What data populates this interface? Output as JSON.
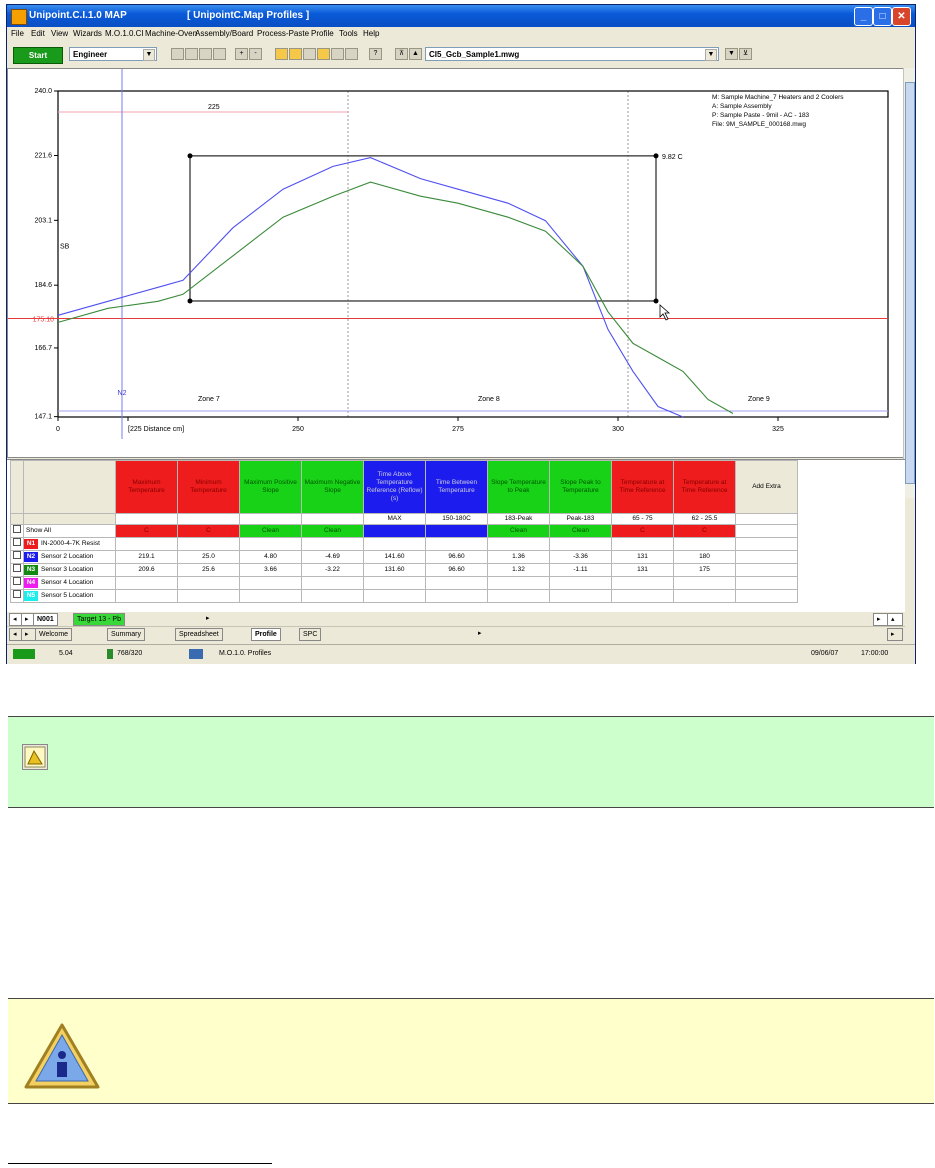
{
  "window": {
    "title_app": "Unipoint.C.I.1.0 MAP",
    "title_doc": "[ UnipointC.Map Profiles ]"
  },
  "menu": [
    "File",
    "Edit",
    "View",
    "Wizards",
    "M.O.1.0.CI",
    "Machine-Oven",
    "Assembly/Board",
    "Process-Paste",
    "Profile",
    "Tools",
    "Help"
  ],
  "toolbar": {
    "start_label": "Start",
    "user_level": "Engineer",
    "profile_file": "CI5_Gcb_Sample1.mwg"
  },
  "chart_data": {
    "type": "line",
    "title": "",
    "xlabel": "[225 Distance cm]",
    "ylabel": "",
    "xlim": [
      0,
      450
    ],
    "ylim": [
      147.0,
      240.0
    ],
    "y_ticks": [
      "240.0",
      "221.6",
      "203.1",
      "184.6",
      "166.7",
      "147.1"
    ],
    "x_ticks": [
      "0",
      "[225 Distance cm]",
      "250",
      "275",
      "300",
      "325"
    ],
    "reference_line_label": "175.10",
    "upper_line_label": "225",
    "left_label": "SB",
    "box_label": "9.82 C",
    "marker_label": "N2",
    "zones": [
      "Zone 7",
      "Zone 8",
      "Zone 9"
    ],
    "info_lines": [
      "M: Sample Machine_7 Heaters and 2 Coolers",
      "A: Sample Assembly",
      "P: Sample Paste - 9mil - AC - 183",
      "File: 9M_SAMPLE_000168.mwg"
    ],
    "box_x": [
      100,
      485
    ],
    "box_y": [
      180.1,
      221.5
    ],
    "series": [
      {
        "color": "#5050f0",
        "x": [
          0,
          40,
          80,
          100,
          140,
          180,
          220,
          250,
          290,
          320,
          360,
          390,
          420,
          440,
          460,
          480,
          500
        ],
        "y": [
          176.0,
          180.0,
          184.0,
          186.0,
          201.0,
          212.0,
          218.5,
          221.0,
          215.0,
          212.0,
          208.0,
          203.0,
          190.0,
          172.0,
          160.0,
          150.0,
          144.0
        ]
      },
      {
        "color": "#3a8a3a",
        "x": [
          0,
          40,
          80,
          100,
          140,
          180,
          220,
          250,
          290,
          320,
          360,
          390,
          420,
          440,
          460,
          480,
          500,
          520,
          540
        ],
        "y": [
          174.0,
          178.0,
          180.0,
          182.0,
          193.0,
          204.0,
          210.0,
          214.0,
          210.0,
          208.0,
          204.0,
          200.0,
          190.0,
          177.0,
          168.0,
          164.0,
          160.0,
          152.0,
          148.0
        ]
      }
    ]
  },
  "grid": {
    "headers": [
      {
        "label": "Maximum Temperature",
        "color": "red"
      },
      {
        "label": "Minimum Temperature",
        "color": "red"
      },
      {
        "label": "Maximum Positive Slope",
        "color": "green"
      },
      {
        "label": "Maximum Negative Slope",
        "color": "green"
      },
      {
        "label": "Time Above Temperature Reference (Reflow) (s)",
        "color": "blue"
      },
      {
        "label": "Time Between Temperature",
        "color": "blue"
      },
      {
        "label": "Slope Temperature to Peak",
        "color": "green"
      },
      {
        "label": "Slope Peak to Temperature",
        "color": "green"
      },
      {
        "label": "Temperature at Time Reference",
        "color": "red"
      },
      {
        "label": "Temperature at Time Reference",
        "color": "red"
      }
    ],
    "add_extra": "Add Extra",
    "params": [
      "",
      "",
      "",
      "",
      "MAX",
      "150-180C",
      "183-Peak",
      "Peak-183",
      "65 - 75",
      "62 - 25.5"
    ],
    "status": [
      "C",
      "C",
      "Clean",
      "Clean",
      "",
      "",
      "Clean",
      "Clean",
      "C",
      "C"
    ],
    "show_all": "Show All",
    "rows": [
      {
        "tag": "N1",
        "color": "#ee1c1c",
        "label": "IN-2000-4-7K Resist",
        "values": [
          "",
          "",
          "",
          "",
          "",
          "",
          "",
          "",
          "",
          ""
        ]
      },
      {
        "tag": "N2",
        "color": "#1c1cee",
        "label": "Sensor 2 Location",
        "values": [
          "219.1",
          "25.0",
          "4.80",
          "-4.69",
          "141.60",
          "96.60",
          "1.36",
          "-3.36",
          "131",
          "180"
        ]
      },
      {
        "tag": "N3",
        "color": "#128a12",
        "label": "Sensor 3 Location",
        "values": [
          "209.6",
          "25.6",
          "3.66",
          "-3.22",
          "131.60",
          "96.60",
          "1.32",
          "-1.11",
          "131",
          "175"
        ]
      },
      {
        "tag": "N4",
        "color": "#ee1cee",
        "label": "Sensor 4 Location",
        "values": [
          "",
          "",
          "",
          "",
          "",
          "",
          "",
          "",
          "",
          ""
        ]
      },
      {
        "tag": "N5",
        "color": "#1ceeee",
        "label": "Sensor 5 Location",
        "values": [
          "",
          "",
          "",
          "",
          "",
          "",
          "",
          "",
          "",
          ""
        ]
      }
    ]
  },
  "sheet_tabs": [
    "N001",
    "Target 13 - Pb"
  ],
  "page_tabs": [
    "Welcome",
    "Summary",
    "Spreadsheet",
    "Profile",
    "SPC"
  ],
  "status_bar": {
    "version": "5.04",
    "mem": "768/320",
    "mode": "M.O.1.0. Profiles",
    "date": "09/06/07",
    "time": "17:00:00"
  }
}
